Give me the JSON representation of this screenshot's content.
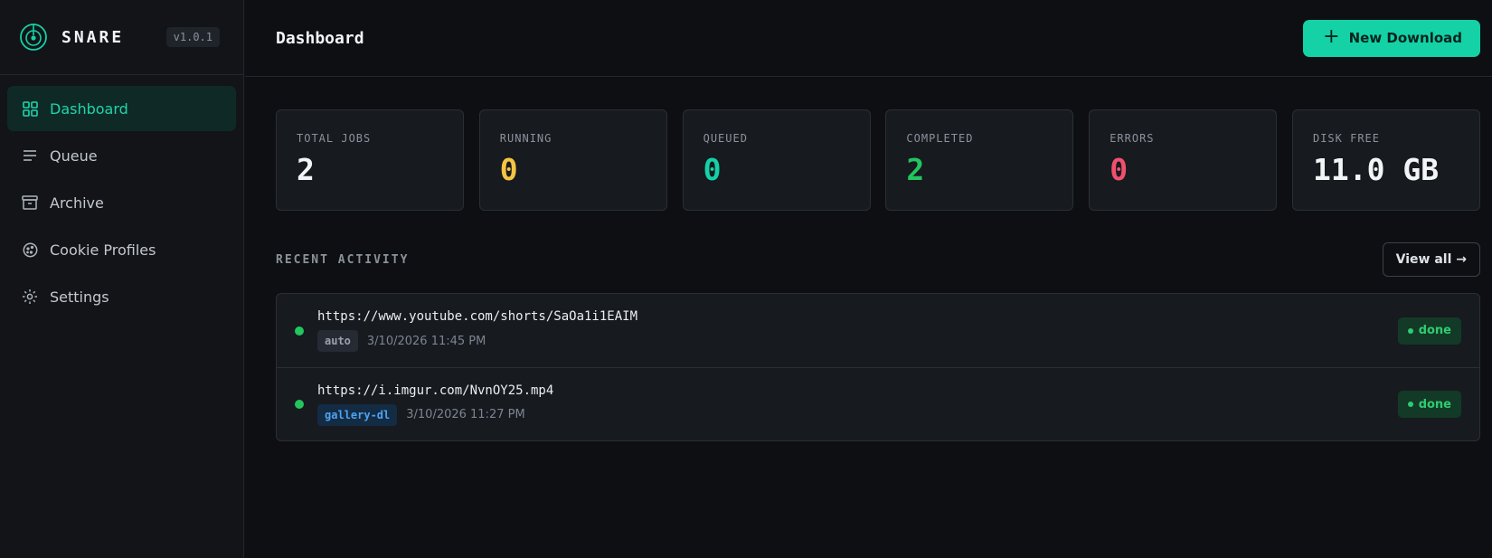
{
  "app": {
    "name": "SNARE",
    "version": "v1.0.1"
  },
  "sidebar": {
    "items": [
      {
        "label": "Dashboard",
        "icon": "grid-icon",
        "active": true
      },
      {
        "label": "Queue",
        "icon": "list-icon",
        "active": false
      },
      {
        "label": "Archive",
        "icon": "archive-icon",
        "active": false
      },
      {
        "label": "Cookie Profiles",
        "icon": "cookie-icon",
        "active": false
      },
      {
        "label": "Settings",
        "icon": "gear-icon",
        "active": false
      }
    ]
  },
  "header": {
    "title": "Dashboard",
    "new_download_label": "New Download"
  },
  "stats": [
    {
      "label": "TOTAL JOBS",
      "value": "2",
      "color": "#f2f4f6"
    },
    {
      "label": "RUNNING",
      "value": "0",
      "color": "#f5c542"
    },
    {
      "label": "QUEUED",
      "value": "0",
      "color": "#14d1a6"
    },
    {
      "label": "COMPLETED",
      "value": "2",
      "color": "#22c55e"
    },
    {
      "label": "ERRORS",
      "value": "0",
      "color": "#f0506e"
    },
    {
      "label": "DISK FREE",
      "value": "11.0 GB",
      "color": "#f2f4f6"
    }
  ],
  "recent": {
    "title": "RECENT ACTIVITY",
    "view_all_label": "View all →",
    "items": [
      {
        "url": "https://www.youtube.com/shorts/SaOa1i1EAIM",
        "engine": "auto",
        "time": "3/10/2026 11:45 PM",
        "status": "done"
      },
      {
        "url": "https://i.imgur.com/NvnOY25.mp4",
        "engine": "gallery-dl",
        "time": "3/10/2026 11:27 PM",
        "status": "done"
      }
    ]
  },
  "colors": {
    "accent": "#14d1a6",
    "done": "#22c55e"
  }
}
